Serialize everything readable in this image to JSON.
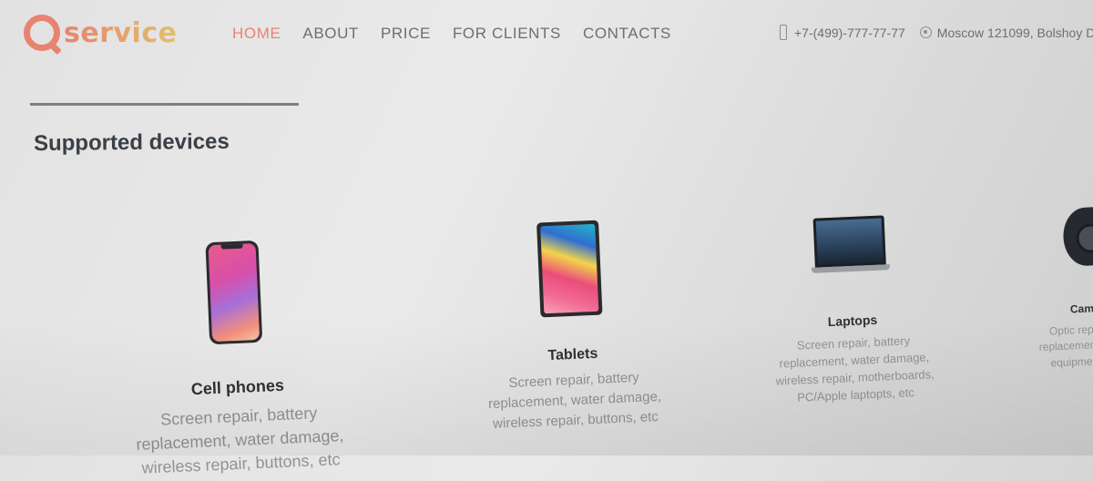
{
  "header": {
    "logo_text": "service",
    "nav": [
      "HOME",
      "ABOUT",
      "PRICE",
      "FOR CLIENTS",
      "CONTACTS"
    ],
    "phone": "+7-(499)-777-77-77",
    "address": "Moscow 121099, Bolshoy D"
  },
  "section": {
    "title": "Supported devices"
  },
  "devices": [
    {
      "name": "Cell phones",
      "desc": [
        "Screen repair, battery",
        "replacement, water damage,",
        "wireless repair, buttons, etc"
      ]
    },
    {
      "name": "Tablets",
      "desc": [
        "Screen repair, battery",
        "replacement, water damage,",
        "wireless repair, buttons, etc"
      ]
    },
    {
      "name": "Laptops",
      "desc": [
        "Screen repair, battery",
        "replacement, water damage,",
        "wireless repair, motherboards,",
        "PC/Apple laptopts, etc"
      ]
    },
    {
      "name": "Cam",
      "desc": [
        "Optic repa",
        "replacement, w",
        "equipment r"
      ]
    }
  ],
  "colors": {
    "accent": "#e9836f",
    "logo_gradient_end": "#e1c06c",
    "background": "#e6e6e6",
    "nav_text": "#6c6f73"
  },
  "icons": [
    "q-logo-icon",
    "phone-icon",
    "location-icon",
    "phone-device-icon",
    "tablet-device-icon",
    "laptop-device-icon",
    "camera-device-icon"
  ]
}
